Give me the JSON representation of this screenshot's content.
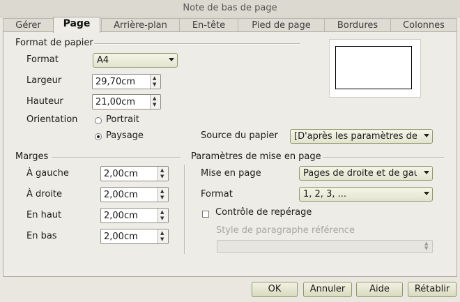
{
  "window": {
    "title": "Note de bas de page"
  },
  "tabs": [
    {
      "label": "Gérer"
    },
    {
      "label": "Page"
    },
    {
      "label": "Arrière-plan"
    },
    {
      "label": "En-tête"
    },
    {
      "label": "Pied de page"
    },
    {
      "label": "Bordures"
    },
    {
      "label": "Colonnes"
    }
  ],
  "paper": {
    "section_title": "Format de papier",
    "format_label": "Format",
    "format_value": "A4",
    "width_label": "Largeur",
    "width_value": "29,70cm",
    "height_label": "Hauteur",
    "height_value": "21,00cm",
    "orientation_label": "Orientation",
    "portrait_label": "Portrait",
    "landscape_label": "Paysage",
    "orientation_selected": "Paysage",
    "source_label": "Source du papier",
    "source_value": "[D'après les paramètres de"
  },
  "margins": {
    "section_title": "Marges",
    "left_label": "À gauche",
    "left_value": "2,00cm",
    "right_label": "À droite",
    "right_value": "2,00cm",
    "top_label": "En haut",
    "top_value": "2,00cm",
    "bottom_label": "En bas",
    "bottom_value": "2,00cm"
  },
  "layout": {
    "section_title": "Paramètres de mise en page",
    "mode_label": "Mise en page",
    "mode_value": "Pages de droite et de gau",
    "format_label": "Format",
    "format_value": "1, 2, 3, ...",
    "register_label": "Contrôle de repérage",
    "register_checked": false,
    "ref_style_label": "Style de paragraphe référence",
    "ref_style_value": ""
  },
  "buttons": {
    "ok": "OK",
    "cancel": "Annuler",
    "help": "Aide",
    "reset": "Rétablir"
  }
}
